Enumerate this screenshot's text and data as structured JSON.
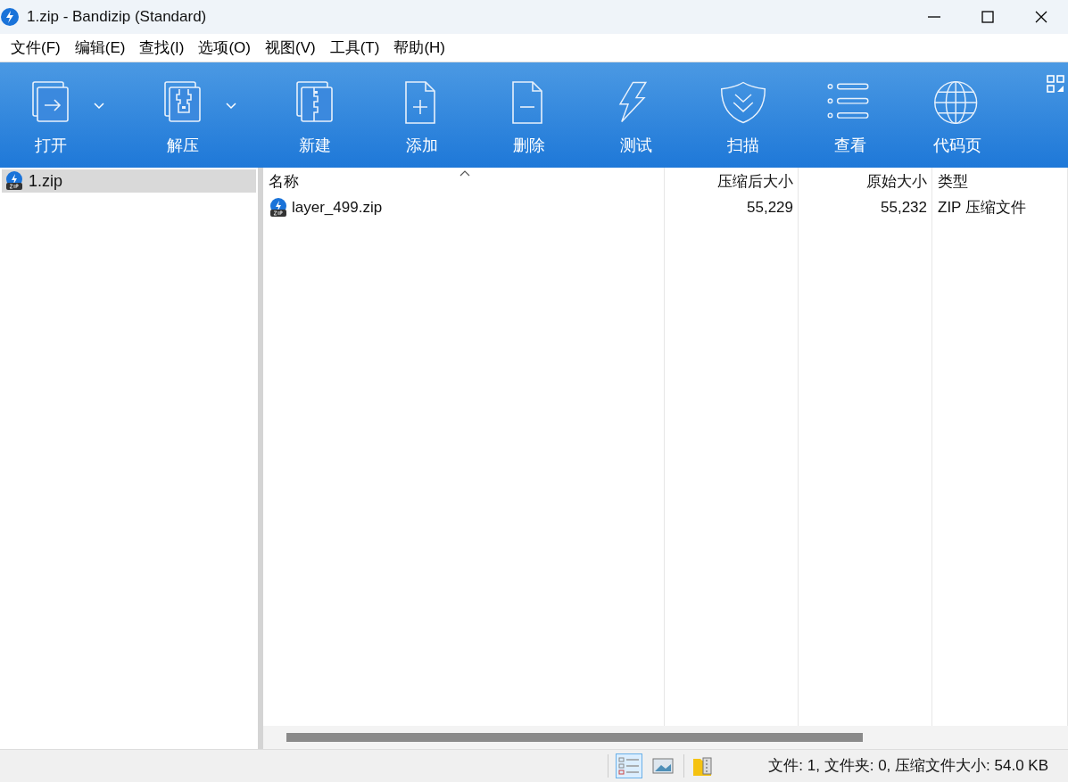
{
  "window": {
    "title": "1.zip - Bandizip (Standard)"
  },
  "menu": [
    "文件(F)",
    "编辑(E)",
    "查找(I)",
    "选项(O)",
    "视图(V)",
    "工具(T)",
    "帮助(H)"
  ],
  "toolbar": [
    {
      "label": "打开",
      "dropdown": true
    },
    {
      "label": "解压",
      "dropdown": true
    },
    {
      "label": "新建",
      "dropdown": false
    },
    {
      "label": "添加",
      "dropdown": false
    },
    {
      "label": "删除",
      "dropdown": false
    },
    {
      "label": "测试",
      "dropdown": false
    },
    {
      "label": "扫描",
      "dropdown": false
    },
    {
      "label": "查看",
      "dropdown": false
    },
    {
      "label": "代码页",
      "dropdown": false
    }
  ],
  "tree": [
    {
      "label": "1.zip",
      "selected": true
    }
  ],
  "table": {
    "columns": [
      {
        "label": "名称",
        "sorted": true
      },
      {
        "label": "压缩后大小",
        "sorted": false
      },
      {
        "label": "原始大小",
        "sorted": false
      },
      {
        "label": "类型",
        "sorted": false
      }
    ],
    "rows": [
      [
        "layer_499.zip",
        "55,229",
        "55,232",
        "ZIP 压缩文件"
      ]
    ]
  },
  "status_bar": {
    "view_buttons": [
      {
        "selected": true
      },
      {
        "selected": false
      }
    ],
    "text": "文件: 1, 文件夹: 0, 压缩文件大小: 54.0 KB"
  }
}
